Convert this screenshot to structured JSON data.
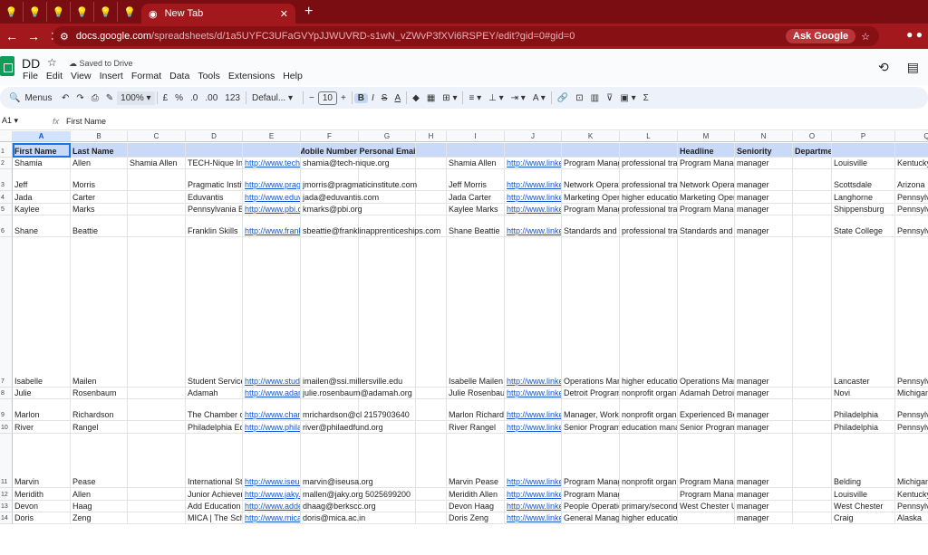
{
  "browser": {
    "tab_title": "New Tab",
    "url_host": "docs.google.com",
    "url_path": "/spreadsheets/d/1a5UYFC3UFaGVYpJJWUVRD-s1wN_vZWvP3fXVi6RSPEY/edit?gid=0#gid=0",
    "ask_google": "Ask Google"
  },
  "sheets": {
    "doc_title": "DD",
    "saved_status": "Saved to Drive",
    "menu": [
      "File",
      "Edit",
      "View",
      "Insert",
      "Format",
      "Data",
      "Tools",
      "Extensions",
      "Help"
    ],
    "toolbar": {
      "search": "Menus",
      "zoom": "100%",
      "currency": "£",
      "percent": "%",
      "dec_decrease": ".0",
      "dec_increase": ".00",
      "number_format": "123",
      "font": "Defaul...",
      "font_size": "10"
    },
    "name_box": "A1",
    "formula_value": "First Name"
  },
  "grid": {
    "columns": [
      "A",
      "B",
      "C",
      "D",
      "E",
      "F",
      "G",
      "H",
      "I",
      "J",
      "K",
      "L",
      "M",
      "N",
      "O",
      "P",
      "Q"
    ],
    "row_numbers": [
      "1",
      "2",
      "3",
      "4",
      "5",
      "6",
      "7",
      "8",
      "9",
      "10",
      "11",
      "12",
      "13",
      "14"
    ],
    "header_row": {
      "A": "First Name",
      "B": "Last Name",
      "FG": "Mobile Number Personal Email",
      "M": "Headline",
      "N": "Seniority",
      "O": "Department"
    },
    "rows": [
      {
        "A": "Shamia",
        "B": "Allen",
        "C": "Shamia Allen",
        "D": "TECH-Nique Inc",
        "E": "http://www.tech-n",
        "F": "shamia@tech-nique.org",
        "I": "Shamia Allen",
        "J": "http://www.linked",
        "K": "Program Manag",
        "L": "professional trai",
        "M": "Program Manag",
        "N": "manager",
        "P": "Louisville",
        "Q": "Kentucky"
      },
      {
        "A": "Jeff",
        "B": "Morris",
        "D": "Pragmatic Institu",
        "E": "http://www.pragm",
        "F": "jmorris@pragmaticinstitute.com",
        "I": "Jeff Morris",
        "J": "http://www.linked",
        "K": "Network Operati",
        "L": "professional trai",
        "M": "Network Operati",
        "N": "manager",
        "P": "Scottsdale",
        "Q": "Arizona"
      },
      {
        "A": "Jada",
        "B": "Carter",
        "D": "Eduvantis",
        "E": "http://www.eduva",
        "F": "jada@eduvantis.com",
        "I": "Jada Carter",
        "J": "http://www.linked",
        "K": "Marketing Opera",
        "L": "higher education",
        "M": "Marketing Opera",
        "N": "manager",
        "P": "Langhorne",
        "Q": "Pennsylva"
      },
      {
        "A": "Kaylee",
        "B": "Marks",
        "D": "Pennsylvania Ba",
        "E": "http://www.pbi.or",
        "F": "kmarks@pbi.org",
        "I": "Kaylee Marks",
        "J": "http://www.linked",
        "K": "Program Manag",
        "L": "professional trai",
        "M": "Program Manag",
        "N": "manager",
        "P": "Shippensburg",
        "Q": "Pennsylva"
      },
      {
        "A": "Shane",
        "B": "Beattie",
        "D": "Franklin Skills",
        "E": "http://www.frankl",
        "F": "sbeattie@franklinapprenticeships.com",
        "I": "Shane Beattie",
        "J": "http://www.linked",
        "K": "Standards and L",
        "L": "professional trai",
        "M": "Standards and L",
        "N": "manager",
        "P": "State College",
        "Q": "Pennsylva"
      },
      {
        "A": "Isabelle",
        "B": "Mailen",
        "D": "Student Services",
        "E": "http://www.stude",
        "F": "imailen@ssi.millersville.edu",
        "I": "Isabelle Mailen",
        "J": "http://www.linked",
        "K": "Operations Mana",
        "L": "higher education",
        "M": "Operations Mana",
        "N": "manager",
        "P": "Lancaster",
        "Q": "Pennsylva"
      },
      {
        "A": "Julie",
        "B": "Rosenbaum",
        "D": "Adamah",
        "E": "http://www.adam",
        "F": "julie.rosenbaum@adamah.org",
        "I": "Julie Rosenbaum",
        "J": "http://www.linked",
        "K": "Detroit Program",
        "L": "nonprofit organiz",
        "M": "Adamah Detroit",
        "N": "manager",
        "P": "Novi",
        "Q": "Michigan"
      },
      {
        "A": "Marlon",
        "B": "Richardson",
        "D": "The Chamber of",
        "E": "http://www.cham",
        "F": "mrichardson@cl 2157903640",
        "I": "Marlon Richards",
        "J": "http://www.linked",
        "K": "Manager, Workp",
        "L": "nonprofit organiz",
        "M": "Experienced Ber",
        "N": "manager",
        "P": "Philadelphia",
        "Q": "Pennsylva"
      },
      {
        "A": "River",
        "B": "Rangel",
        "D": "Philadelphia Edu",
        "E": "http://www.philae",
        "F": "river@philaedfund.org",
        "I": "River Rangel",
        "J": "http://www.linked",
        "K": "Senior Program",
        "L": "education mana",
        "M": "Senior Program",
        "N": "manager",
        "P": "Philadelphia",
        "Q": "Pennsylva"
      },
      {
        "A": "Marvin",
        "B": "Pease",
        "D": "International Stu",
        "E": "http://www.iseus",
        "F": "marvin@iseusa.org",
        "I": "Marvin Pease",
        "J": "http://www.linked",
        "K": "Program Manag",
        "L": "nonprofit organiz",
        "M": "Program Manag",
        "N": "manager",
        "P": "Belding",
        "Q": "Michigan"
      },
      {
        "A": "Meridith",
        "B": "Allen",
        "D": "Junior Achievem",
        "E": "http://www.jaky.o",
        "F": "mallen@jaky.org 5025699200",
        "I": "Meridith Allen",
        "J": "http://www.linked",
        "K": "Program Manager",
        "M": "Program Manag",
        "N": "manager",
        "P": "Louisville",
        "Q": "Kentucky"
      },
      {
        "A": "Devon",
        "B": "Haag",
        "D": "Add Education",
        "E": "http://www.adde",
        "F": "dhaag@berkscc.org",
        "I": "Devon Haag",
        "J": "http://www.linked",
        "K": "People Operatio",
        "L": "primary/seconda",
        "M": "West Chester Ur",
        "N": "manager",
        "P": "West Chester",
        "Q": "Pennsylva"
      },
      {
        "A": "Doris",
        "B": "Zeng",
        "D": "MICA | The Scho",
        "E": "http://www.mica",
        "F": "doris@mica.ac.in",
        "I": "Doris Zeng",
        "J": "http://www.linked",
        "K": "General Manag",
        "L": "higher education",
        "N": "manager",
        "P": "Craig",
        "Q": "Alaska"
      }
    ]
  }
}
